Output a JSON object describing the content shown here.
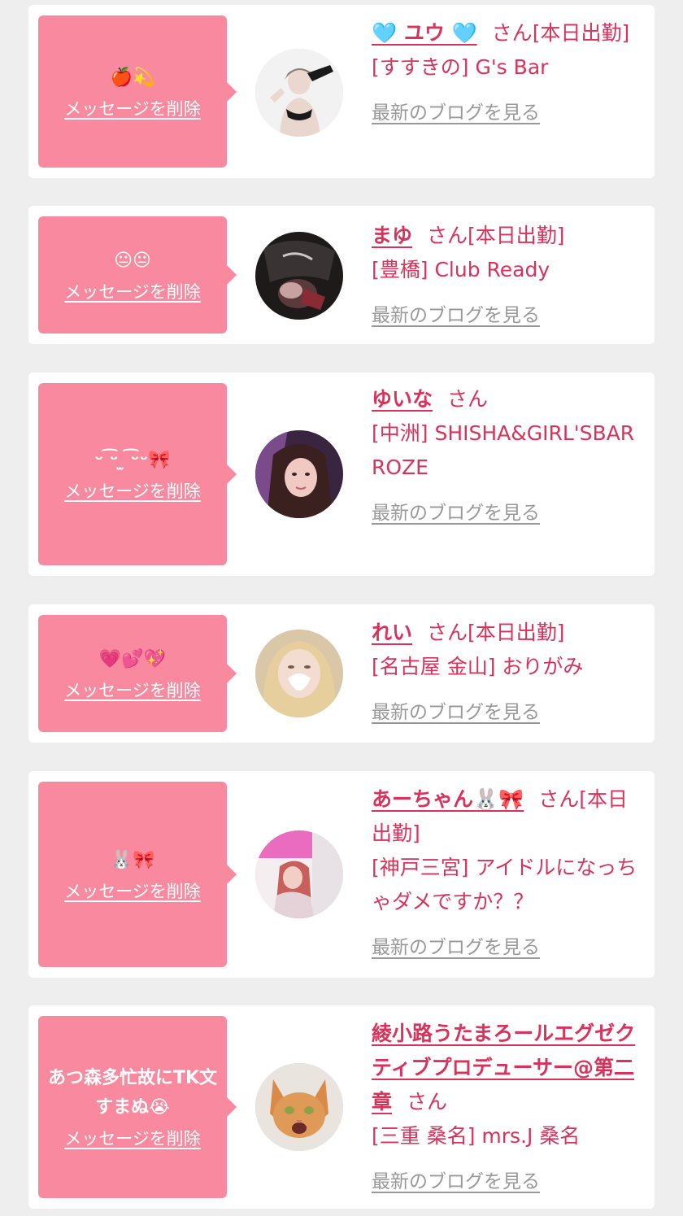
{
  "colors": {
    "background": "#eeeeee",
    "card": "#ffffff",
    "bubble": "#f8899f",
    "accent": "#d9335b",
    "link_gray": "#999999"
  },
  "delete_label": "メッセージを削除",
  "blog_label": "最新のブログを見る",
  "entries": [
    {
      "message": "🍎💫",
      "name": "🩵 ユウ 🩵",
      "san": "さん",
      "status": "[本日出勤]",
      "shop": "[すすきの] G's Bar"
    },
    {
      "message": "😐😐",
      "name": "まゆ",
      "san": "さん",
      "status": "[本日出勤]",
      "shop": "[豊橋] Club Ready"
    },
    {
      "message": "ᵕ ͡ᵕ ̫ ͡ᵕᵕ🎀",
      "name": "ゆいな",
      "san": "さん",
      "status": "",
      "shop": "[中洲] SHISHA&GIRL'SBAR ROZE"
    },
    {
      "message": "💗💕💖",
      "name": "れい",
      "san": "さん",
      "status": "[本日出勤]",
      "shop": "[名古屋 金山] おりがみ"
    },
    {
      "message": "🐰🎀",
      "name": "あーちゃん🐰🎀",
      "san": "さん",
      "status": "[本日出勤]",
      "shop": "[神戸三宮] アイドルになっちゃダメですか？？"
    },
    {
      "message": "あつ森多忙故にTK文すまぬ😭",
      "name": "綾小路うたまろールエグゼクティブプロデューサー@第二章",
      "san": "さん",
      "status": "",
      "shop": "[三重 桑名] mrs.J 桑名"
    }
  ]
}
